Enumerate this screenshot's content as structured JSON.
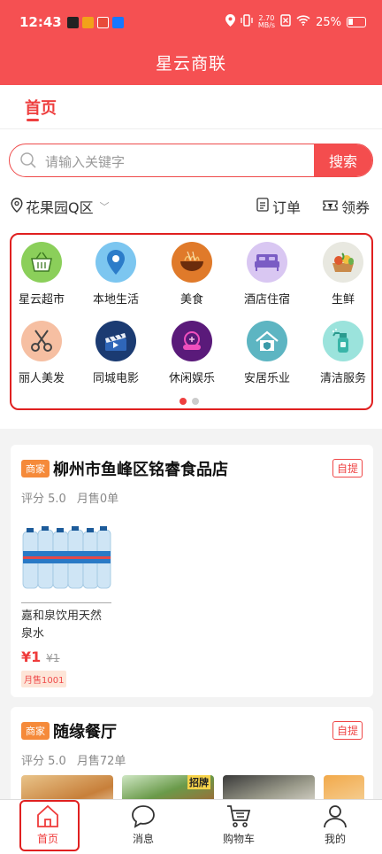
{
  "status_bar": {
    "time": "12:43",
    "net_speed_value": "2.70",
    "net_speed_unit": "MB/s",
    "battery": "25%"
  },
  "app": {
    "title": "星云商联"
  },
  "tabs": {
    "active": "首页"
  },
  "search": {
    "placeholder": "请输入关键字",
    "button": "搜索"
  },
  "location": {
    "area": "花果园Q区",
    "orders": "订单",
    "coupons": "领券"
  },
  "categories": [
    {
      "label": "星云超市",
      "icon": "shopping-basket-icon",
      "color": "#8bcf5a"
    },
    {
      "label": "本地生活",
      "icon": "map-pin-icon",
      "color": "#7cc6f0"
    },
    {
      "label": "美食",
      "icon": "noodles-icon",
      "color": "#e07a2a"
    },
    {
      "label": "酒店住宿",
      "icon": "bed-icon",
      "color": "#d9c7f2"
    },
    {
      "label": "生鲜",
      "icon": "fresh-food-icon",
      "color": "#e8e8e0"
    },
    {
      "label": "丽人美发",
      "icon": "scissors-icon",
      "color": "#f6bfa2"
    },
    {
      "label": "同城电影",
      "icon": "clapperboard-icon",
      "color": "#1b3b72"
    },
    {
      "label": "休闲娱乐",
      "icon": "gamepad-icon",
      "color": "#5a1a7a"
    },
    {
      "label": "安居乐业",
      "icon": "house-shield-icon",
      "color": "#5db5c2"
    },
    {
      "label": "清洁服务",
      "icon": "spray-bottle-icon",
      "color": "#9be3dc"
    }
  ],
  "pager": {
    "pages": 2,
    "active": 1
  },
  "shops": [
    {
      "tag": "商家",
      "name": "柳州市鱼峰区铭睿食品店",
      "pickup": "自提",
      "rating": "评分 5.0",
      "monthly_sales": "月售0单",
      "product": {
        "name": "嘉和泉饮用天然泉水",
        "price": "¥1",
        "old_price": "¥1",
        "sold": "月售1001"
      }
    },
    {
      "tag": "商家",
      "name": "随缘餐厅",
      "pickup": "自提",
      "rating": "评分 5.0",
      "monthly_sales": "月售72单",
      "thumb_badge": "招牌"
    }
  ],
  "bottom_nav": [
    {
      "label": "首页",
      "icon": "home-icon"
    },
    {
      "label": "消息",
      "icon": "message-icon"
    },
    {
      "label": "购物车",
      "icon": "cart-icon"
    },
    {
      "label": "我的",
      "icon": "user-icon"
    }
  ],
  "colors": {
    "brand": "#f55052",
    "accent": "#ee3f3f",
    "highlight_box": "#e02020"
  }
}
